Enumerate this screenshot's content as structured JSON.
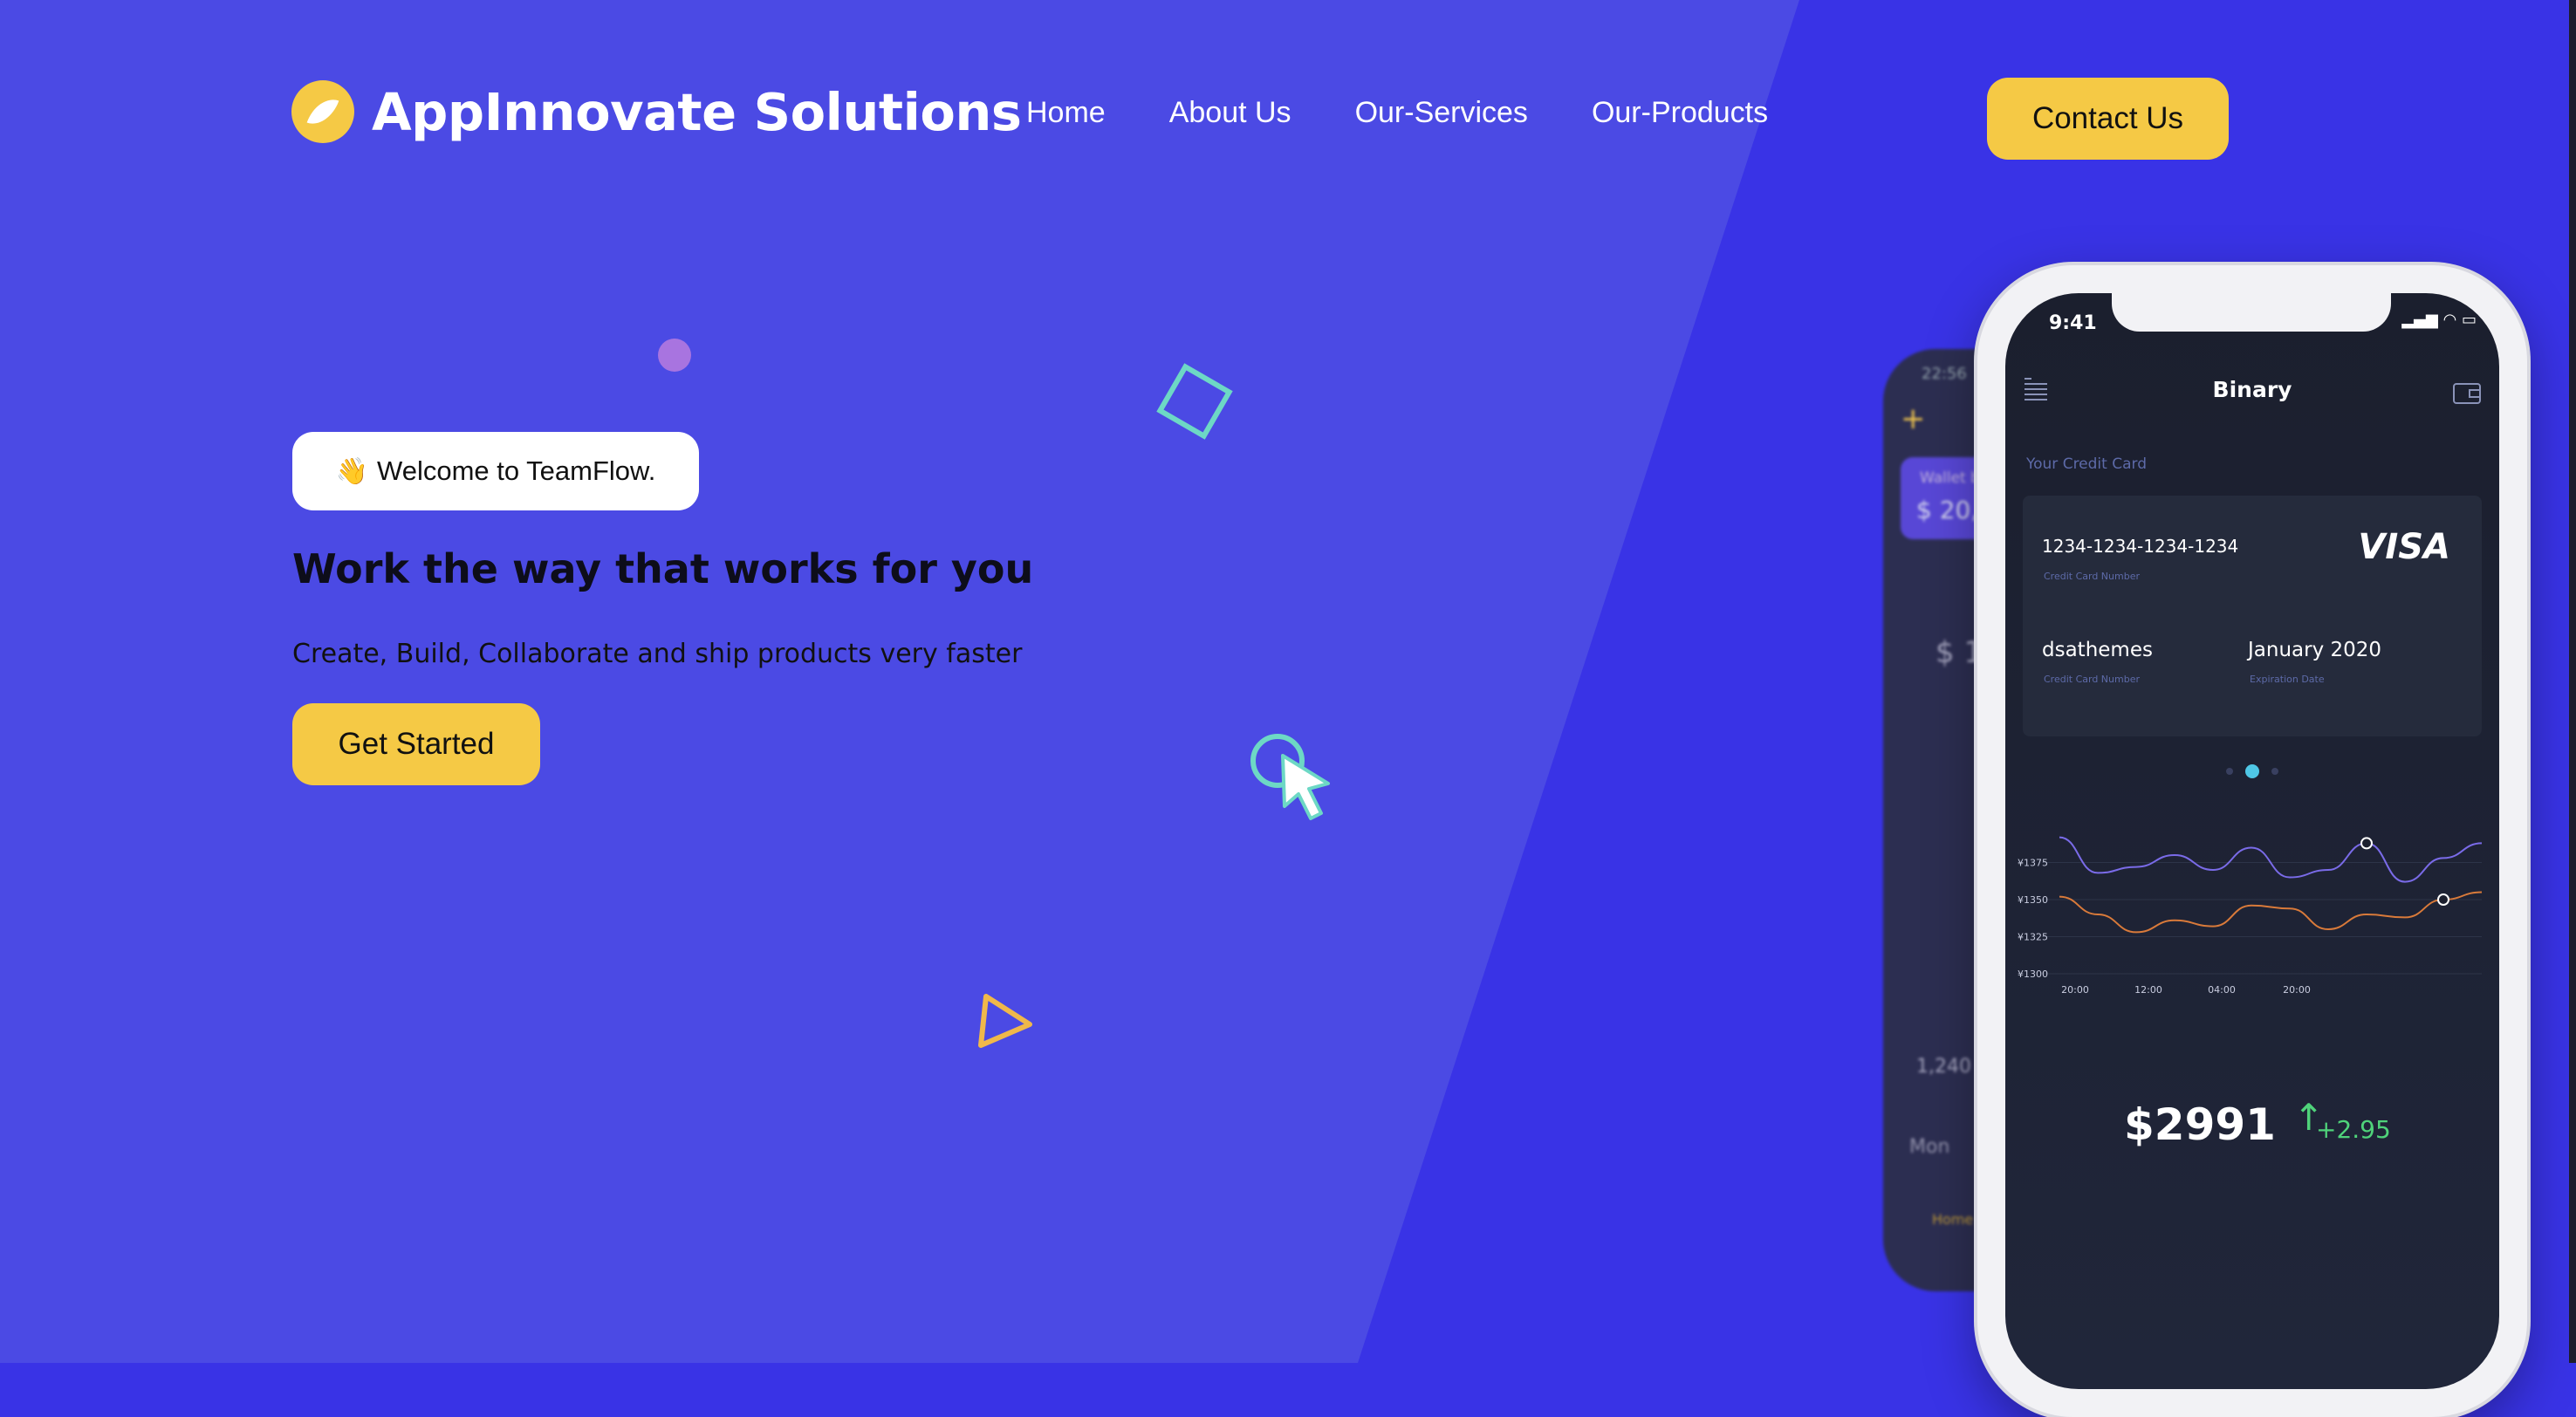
{
  "brand": {
    "name": "AppInnovate Solutions",
    "logo_icon": "leaf-icon",
    "accent": "#f5c945"
  },
  "nav": {
    "items": [
      {
        "label": "Home"
      },
      {
        "label": "About Us"
      },
      {
        "label": "Our-Services"
      },
      {
        "label": "Our-Products"
      }
    ],
    "contact_label": "Contact Us"
  },
  "hero": {
    "badge_emoji": "👋",
    "badge_text": "Welcome to TeamFlow.",
    "title": "Work the way that works for you",
    "subtitle": "Create, Build, Collaborate and ship products very faster",
    "cta_label": "Get Started"
  },
  "colors": {
    "background": "#3933e6",
    "panel": "#4b4ae4",
    "button": "#f5c945"
  },
  "phone_back": {
    "time": "22:56",
    "card_label": "Wallet b",
    "card_value": "$ 20,",
    "balance": "$ 1,",
    "value": "1,240",
    "day": "Mon",
    "tab": "Home"
  },
  "phone": {
    "status_time": "9:41",
    "app_title": "Binary",
    "card_section_label": "Your Credit Card",
    "card_number": "1234-1234-1234-1234",
    "card_number_caption": "Credit Card Number",
    "card_brand": "VISA",
    "holder_name": "dsathemes",
    "holder_caption": "Credit Card Number",
    "expiry": "January 2020",
    "expiry_caption": "Expiration Date",
    "price": "$2991",
    "change": "+2.95"
  },
  "chart_data": {
    "type": "line",
    "y_ticks": [
      "¥1375",
      "¥1350",
      "¥1325",
      "¥1300"
    ],
    "x_ticks": [
      "20:00",
      "12:00",
      "04:00",
      "20:00"
    ],
    "ylim": [
      1300,
      1400
    ],
    "series": [
      {
        "color": "#7a6be8",
        "values": [
          1392,
          1368,
          1372,
          1380,
          1370,
          1385,
          1365,
          1370,
          1388,
          1362,
          1378,
          1388
        ]
      },
      {
        "color": "#d97a3a",
        "values": [
          1352,
          1340,
          1328,
          1336,
          1332,
          1346,
          1344,
          1330,
          1340,
          1338,
          1350,
          1355
        ]
      }
    ]
  }
}
